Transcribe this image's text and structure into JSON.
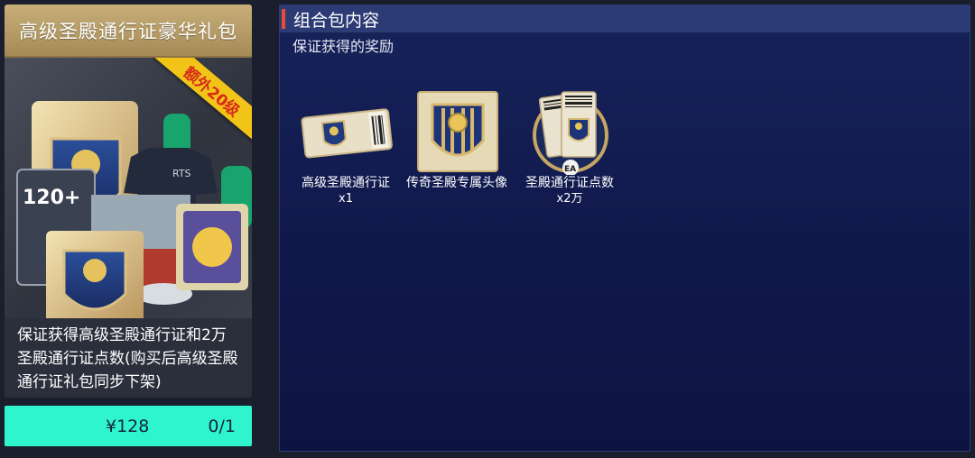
{
  "pack": {
    "title": "高级圣殿通行证豪华礼包",
    "ribbon": "额外20级",
    "art_badge": "120+",
    "description": "保证获得高级圣殿通行证和2万圣殿通行证点数(购买后高级圣殿通行证礼包同步下架)",
    "price": "¥128",
    "purchase_count": "0/1",
    "colors": {
      "title_gold": "#c7ae79",
      "buy_button": "#2ef5cd",
      "ribbon": "#f2c418"
    }
  },
  "contents": {
    "title": "组合包内容",
    "subtitle": "保证获得的奖励",
    "items": [
      {
        "icon": "pass-ticket-icon",
        "name": "高级圣殿通行证",
        "qty": "x1"
      },
      {
        "icon": "shield-avatar-icon",
        "name": "传奇圣殿专属头像",
        "qty": ""
      },
      {
        "icon": "pass-points-icon",
        "name": "圣殿通行证点数",
        "qty": "x2万"
      }
    ],
    "colors": {
      "panel_bg": "#16235a",
      "header_bg": "#2d3b75",
      "accent": "#e84a36"
    }
  }
}
